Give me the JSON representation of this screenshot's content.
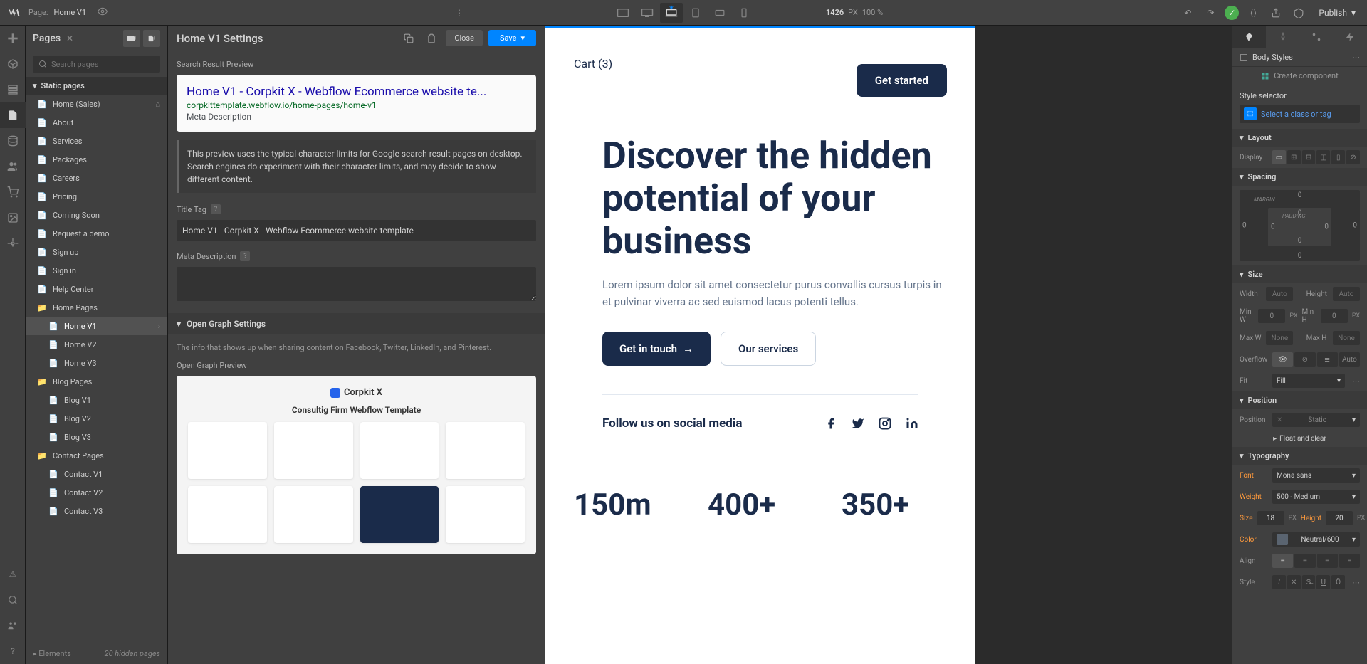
{
  "topbar": {
    "page_prefix": "Page:",
    "page_name": "Home V1",
    "viewport_size": "1426",
    "viewport_unit": "PX",
    "zoom": "100 %",
    "publish": "Publish"
  },
  "pages": {
    "title": "Pages",
    "search_placeholder": "Search pages",
    "static_header": "Static pages",
    "items": [
      {
        "label": "Home (Sales)",
        "home": true
      },
      {
        "label": "About"
      },
      {
        "label": "Services"
      },
      {
        "label": "Packages"
      },
      {
        "label": "Careers"
      },
      {
        "label": "Pricing"
      },
      {
        "label": "Coming Soon"
      },
      {
        "label": "Request a demo"
      },
      {
        "label": "Sign up"
      },
      {
        "label": "Sign in"
      },
      {
        "label": "Help Center"
      }
    ],
    "home_pages": {
      "label": "Home Pages",
      "items": [
        "Home V1",
        "Home V2",
        "Home V3"
      ],
      "active": "Home V1"
    },
    "blog_pages": {
      "label": "Blog Pages",
      "items": [
        "Blog V1",
        "Blog V2",
        "Blog V3"
      ]
    },
    "contact_pages": {
      "label": "Contact Pages",
      "items": [
        "Contact V1",
        "Contact V2",
        "Contact V3"
      ]
    },
    "elements_label": "Elements",
    "hidden_count": "20 hidden pages"
  },
  "settings": {
    "title": "Home V1 Settings",
    "close": "Close",
    "save": "Save",
    "serp_label": "Search Result Preview",
    "serp_title": "Home V1 - Corpkit X - Webflow Ecommerce website te...",
    "serp_url": "corpkittemplate.webflow.io/home-pages/home-v1",
    "serp_desc": "Meta Description",
    "info_text": "This preview uses the typical character limits for Google search result pages on desktop. Search engines do experiment with their character limits, and may decide to show different content.",
    "title_tag_label": "Title Tag",
    "title_tag_value": "Home V1 - Corpkit X - Webflow Ecommerce website template",
    "meta_desc_label": "Meta Description",
    "og_header": "Open Graph Settings",
    "og_info": "The info that shows up when sharing content on Facebook, Twitter, LinkedIn, and Pinterest.",
    "og_preview_label": "Open Graph Preview",
    "og_logo": "Corpkit X",
    "og_tagline": "Consultig Firm Webflow Template"
  },
  "canvas": {
    "cart": "Cart (3)",
    "get_started": "Get started",
    "hero_title": "Discover the hidden potential of your business",
    "hero_sub": "Lorem ipsum dolor sit amet consectetur purus convallis cursus turpis in et pulvinar viverra ac sed euismod lacus potenti tellus.",
    "btn_primary": "Get in touch",
    "btn_secondary": "Our services",
    "social_label": "Follow us on social media",
    "stats": [
      {
        "num": "150m"
      },
      {
        "num": "400+"
      },
      {
        "num": "350+"
      }
    ]
  },
  "style": {
    "body_styles": "Body Styles",
    "create_comp": "Create component",
    "selector_label": "Style selector",
    "selector_placeholder": "Select a class or tag",
    "layout": "Layout",
    "display": "Display",
    "spacing": "Spacing",
    "margin": "MARGIN",
    "padding": "PADDING",
    "zero": "0",
    "size": "Size",
    "width": "Width",
    "height": "Height",
    "min_w": "Min W",
    "min_h": "Min H",
    "max_w": "Max W",
    "max_h": "Max H",
    "auto": "Auto",
    "none": "None",
    "px": "PX",
    "zero_val": "0",
    "overflow": "Overflow",
    "fit": "Fit",
    "fill": "Fill",
    "position": "Position",
    "static": "Static",
    "float_clear": "Float and clear",
    "typography": "Typography",
    "font": "Font",
    "font_value": "Mona sans",
    "weight": "Weight",
    "weight_value": "500 - Medium",
    "size_label": "Size",
    "size_value": "18",
    "line_height": "Height",
    "line_height_value": "20",
    "color": "Color",
    "color_value": "Neutral/600",
    "align": "Align",
    "style_label": "Style"
  }
}
